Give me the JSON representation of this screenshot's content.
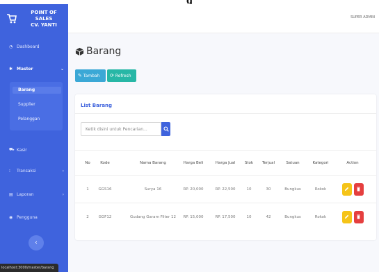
{
  "top_heading": "g",
  "brand": {
    "line1": "POINT OF",
    "line2": "SALES",
    "line3": "CV. YANTI"
  },
  "sidebar": {
    "items": [
      {
        "label": "Dashboard",
        "icon": "dashboard-icon"
      },
      {
        "label": "Master",
        "icon": "gear-icon"
      },
      {
        "label": "Kasir",
        "icon": "cart-icon"
      },
      {
        "label": "Transaksi",
        "icon": "list-icon"
      },
      {
        "label": "Laporan",
        "icon": "report-icon"
      },
      {
        "label": "Pengguna",
        "icon": "user-icon"
      }
    ],
    "sub_items": [
      "Barang",
      "Supplier",
      "Pelanggan"
    ],
    "collapse_glyph": "‹"
  },
  "status_bar": "localhost:3000/master/barang",
  "topbar": {
    "user": "SUPER ADMIN"
  },
  "page": {
    "title": "Barang",
    "add_label": "Tambah",
    "refresh_label": "Refresh"
  },
  "card": {
    "title": "List Barang",
    "search_placeholder": "Ketik disini untuk Pencarian..."
  },
  "table": {
    "headers": [
      "No",
      "Kode",
      "Nama Barang",
      "Harga Beli",
      "Harga Jual",
      "Stok",
      "Terjual",
      "Satuan",
      "Kategori",
      "Action"
    ],
    "rows": [
      [
        "1",
        "GGS16",
        "Surya 16",
        "RP. 20,000",
        "RP. 22,500",
        "10",
        "30",
        "Bungkus",
        "Rokok"
      ],
      [
        "2",
        "GGF12",
        "Gudang Garam Filter 12",
        "RP. 15,000",
        "RP. 17,500",
        "10",
        "42",
        "Bungkus",
        "Rokok"
      ]
    ]
  },
  "colors": {
    "sidebar": "#3f63dd",
    "edit": "#f5c419",
    "delete": "#e53f3f",
    "add": "#3ba8d6",
    "refresh": "#27b7a6"
  }
}
